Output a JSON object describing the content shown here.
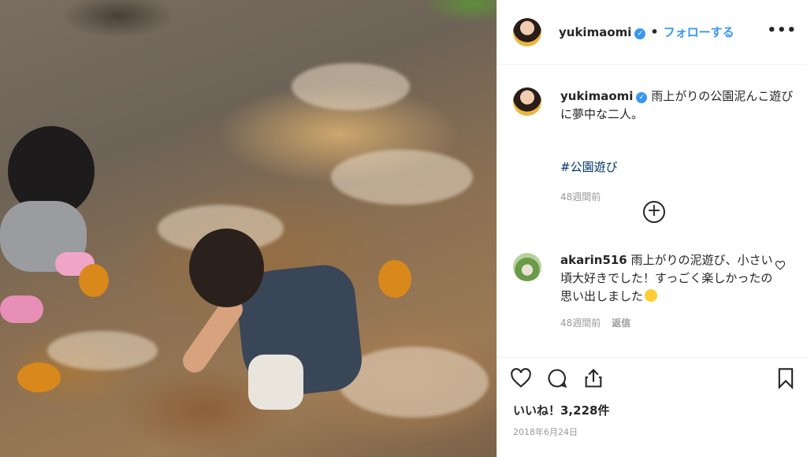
{
  "photo": {
    "alt": ""
  },
  "header": {
    "username": "yukimaomi",
    "separator": "•",
    "follow_label": "フォローする",
    "more_label": "•••"
  },
  "caption": {
    "username": "yukimaomi",
    "text": "雨上がりの公園泥んこ遊びに夢中な二人。",
    "hashtag": "#公園遊び",
    "time": "48週間前"
  },
  "load_more_label": "+",
  "comment": {
    "username": "akarin516",
    "text": "雨上がりの泥遊び、小さい頃大好きでした！すっごく楽しかったの思い出しました",
    "time": "48週間前",
    "reply_label": "返信"
  },
  "actions": {
    "likes": "いいね！3,228件",
    "date": "2018年6月24日"
  },
  "icons": {
    "like": "heart-icon",
    "comment": "comment-bubble-icon",
    "share": "share-icon",
    "save": "bookmark-icon",
    "verified": "verified-badge-icon"
  },
  "colors": {
    "link": "#3897f0",
    "hashtag": "#003569",
    "muted": "#999999"
  }
}
